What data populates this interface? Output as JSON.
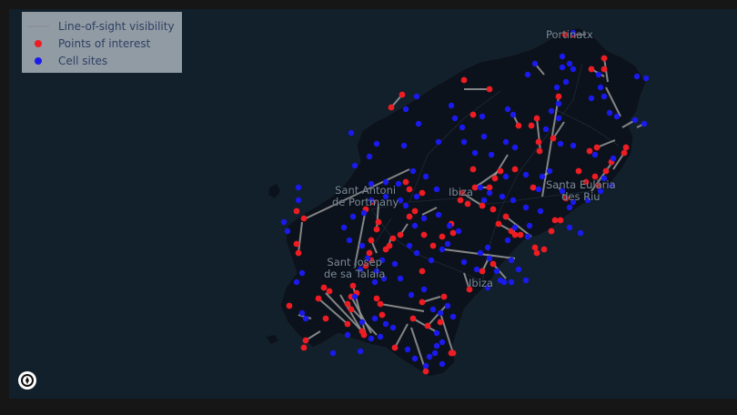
{
  "legend": {
    "line_label": "Line-of-sight visibility",
    "poi_label": "Points of interest",
    "cell_label": "Cell sites"
  },
  "colors": {
    "background": "#11202b",
    "land": "#0c121b",
    "line_of_sight": "#9a9a9a",
    "poi": "#ee1c23",
    "cell": "#1a1aee"
  },
  "places": [
    {
      "name": "Portinatx"
    },
    {
      "name": "Sant Antoni\nde Portmany"
    },
    {
      "name": "Ibiza"
    },
    {
      "name": "Santa Eulària\ndes Riu"
    },
    {
      "name": "Sant Josep\nde sa Talaia"
    },
    {
      "name": "Ibiza"
    }
  ],
  "nav_icon": "compass-icon"
}
